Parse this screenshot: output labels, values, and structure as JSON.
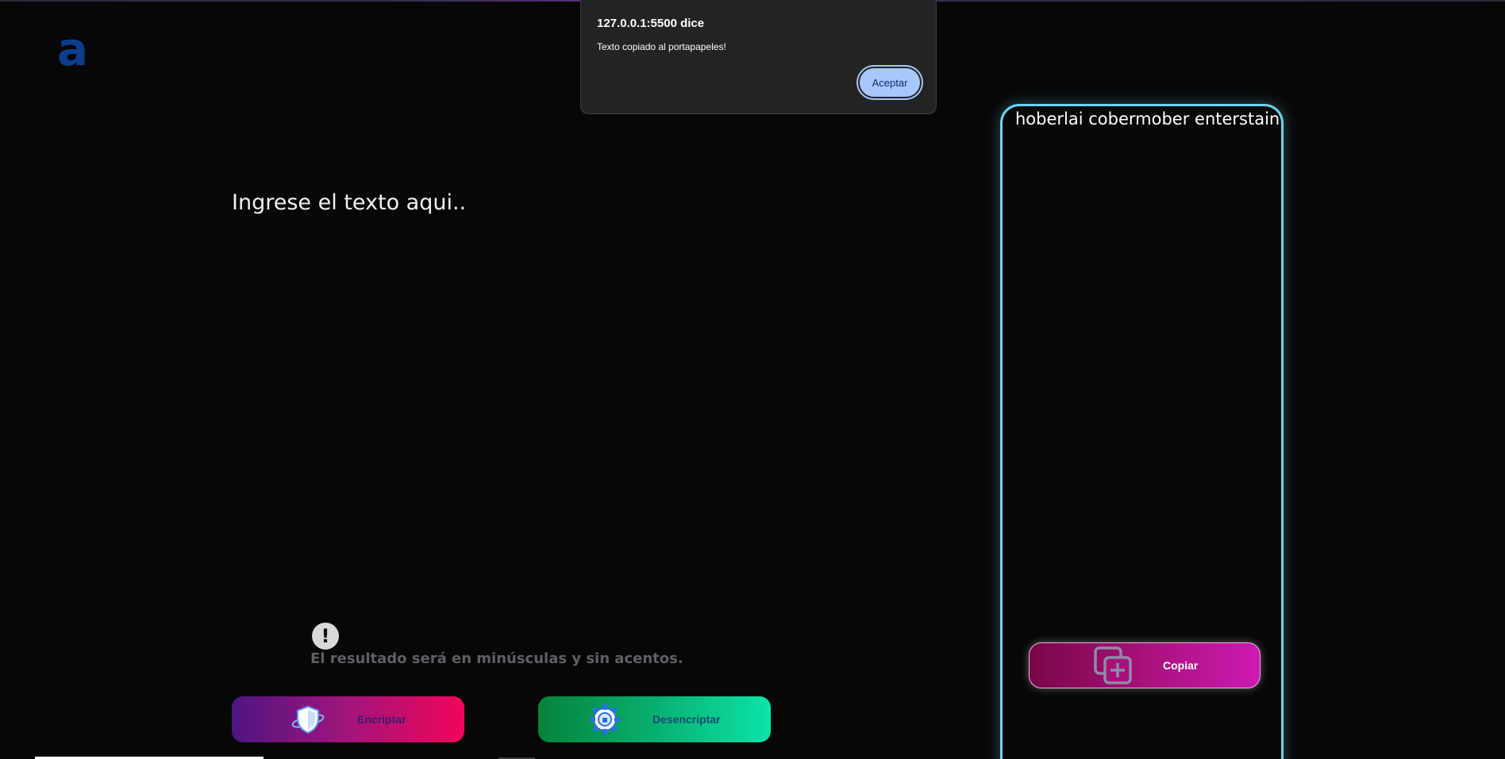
{
  "logo": {
    "letter": "a"
  },
  "editor": {
    "placeholder": "Ingrese el texto aqui.."
  },
  "notice": {
    "icon": "exclamation-icon",
    "icon_glyph": "!",
    "text": "El resultado será en minúsculas y sin acentos."
  },
  "actions": {
    "encrypt_label": "Encriptar",
    "decrypt_label": "Desencriptar"
  },
  "output": {
    "text": "hoberlai  cobermober enterstain",
    "copy_label": "Copiar"
  },
  "dialog": {
    "title": "127.0.0.1:5500 dice",
    "message": "Texto copiado al portapapeles!",
    "ok_label": "Aceptar"
  },
  "colors": {
    "panel_border": "#6dd3ef",
    "encrypt_gradient": [
      "#4d1581",
      "#f2055a"
    ],
    "decrypt_gradient": [
      "#05833a",
      "#0de3a8"
    ],
    "copy_gradient": [
      "#780647",
      "#cc1ab2"
    ],
    "dialog_button": "#a8c7fa"
  }
}
